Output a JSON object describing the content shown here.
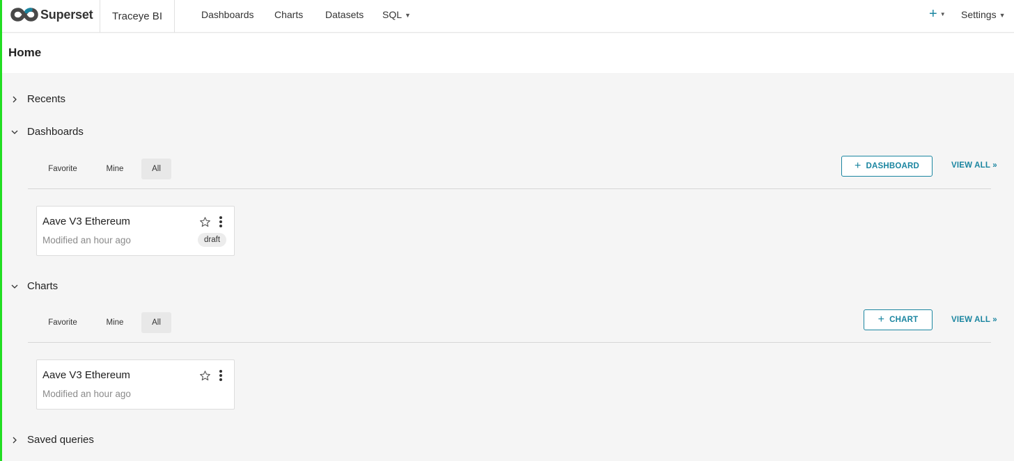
{
  "app": {
    "brand": "Superset",
    "workspace": "Traceye BI"
  },
  "nav": {
    "items": [
      {
        "label": "Dashboards"
      },
      {
        "label": "Charts"
      },
      {
        "label": "Datasets"
      },
      {
        "label": "SQL"
      }
    ],
    "plus": "+",
    "settings": "Settings"
  },
  "page": {
    "title": "Home"
  },
  "sections": {
    "recents": {
      "label": "Recents",
      "expanded": false
    },
    "dashboards": {
      "label": "Dashboards",
      "expanded": true,
      "tabs": [
        "Favorite",
        "Mine",
        "All"
      ],
      "active_tab": "All",
      "add_label": "DASHBOARD",
      "view_all": "VIEW ALL »",
      "cards": [
        {
          "title": "Aave V3 Ethereum",
          "modified": "Modified an hour ago",
          "badge": "draft"
        }
      ]
    },
    "charts": {
      "label": "Charts",
      "expanded": true,
      "tabs": [
        "Favorite",
        "Mine",
        "All"
      ],
      "active_tab": "All",
      "add_label": "CHART",
      "view_all": "VIEW ALL »",
      "cards": [
        {
          "title": "Aave V3 Ethereum",
          "modified": "Modified an hour ago"
        }
      ]
    },
    "saved_queries": {
      "label": "Saved queries",
      "expanded": false
    }
  },
  "icons": {
    "logo": "superset-infinity-logo",
    "chevron_right": "chevron-right-icon",
    "chevron_down": "chevron-down-icon",
    "star": "star-outline-icon",
    "more": "more-vertical-icon"
  },
  "colors": {
    "accent": "#1a85a0",
    "background": "#f5f5f5",
    "logo_ring": "#1a85a0"
  }
}
